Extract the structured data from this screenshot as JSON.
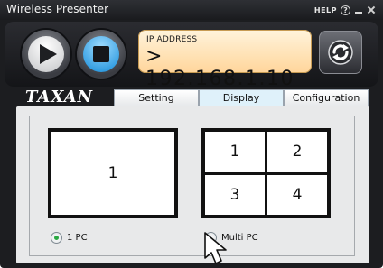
{
  "window": {
    "title": "Wireless Presenter"
  },
  "titlebar": {
    "help_label": "HELP",
    "help_icon_glyph": "?"
  },
  "controls": {
    "play": {
      "icon": "play-icon"
    },
    "stop": {
      "icon": "stop-icon"
    },
    "ip_label": "IP ADDRESS",
    "ip_value": "> 192.168.1.10",
    "refresh": {
      "icon": "refresh-icon"
    }
  },
  "brand": {
    "logo_text": "TAXAN"
  },
  "tabs": [
    {
      "label": "Setting",
      "selected": false
    },
    {
      "label": "Display",
      "selected": true
    },
    {
      "label": "Configuration",
      "selected": false
    }
  ],
  "display": {
    "single_layout": {
      "cell": "1"
    },
    "multi_layout": {
      "cells": [
        "1",
        "2",
        "3",
        "4"
      ]
    },
    "options": [
      {
        "label": "1 PC",
        "selected": true
      },
      {
        "label": "Multi PC",
        "selected": false
      }
    ]
  },
  "colors": {
    "window_bg": "#1c1d20",
    "ip_panel": "#ffe2b2",
    "stop_accent": "#2f9be0",
    "selected_radio": "#2aa842",
    "selected_tab": "#dff1fa"
  }
}
